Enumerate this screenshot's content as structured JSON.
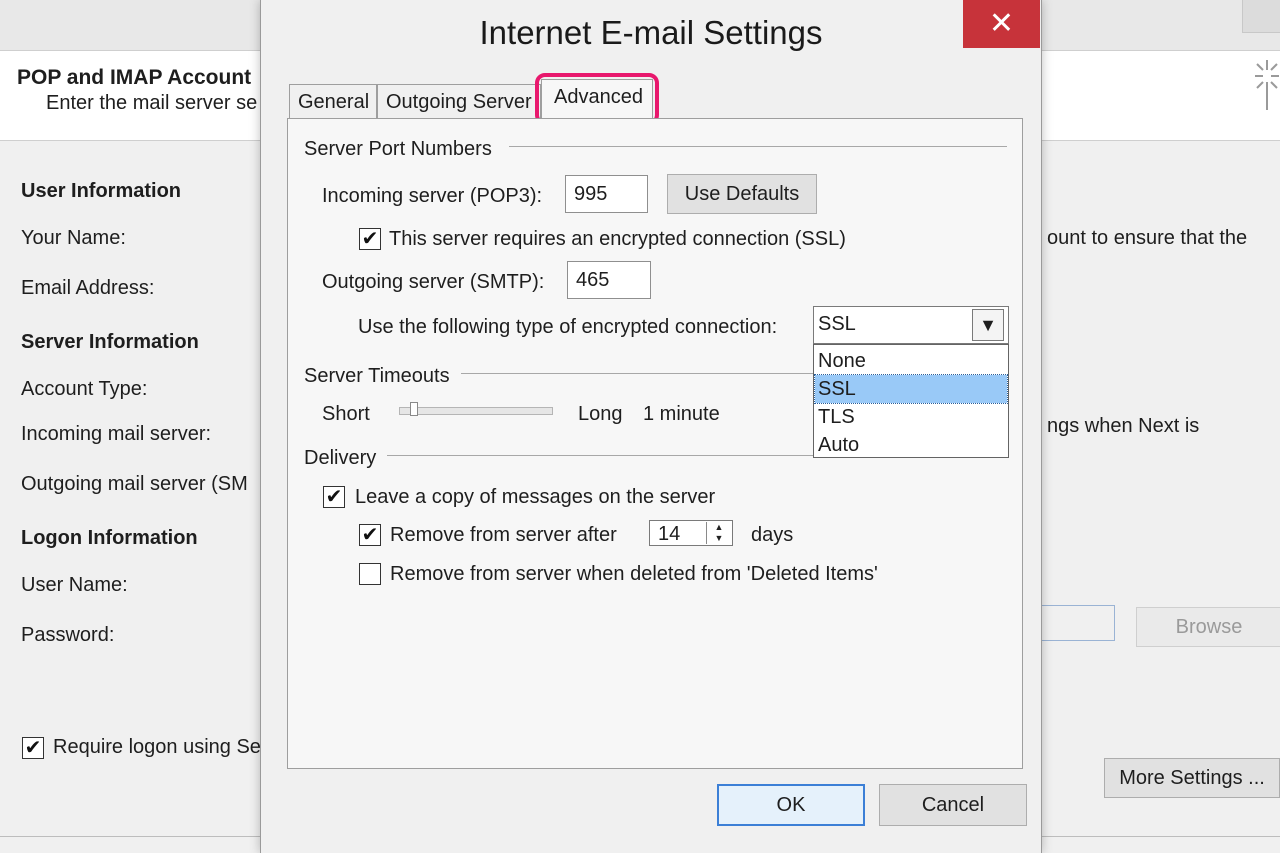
{
  "background": {
    "header_title": "POP and IMAP Account",
    "header_subtitle": "Enter the mail server se",
    "user_info_heading": "User Information",
    "your_name_label": "Your Name:",
    "email_label": "Email Address:",
    "server_info_heading": "Server Information",
    "account_type_label": "Account Type:",
    "incoming_label": "Incoming mail server:",
    "outgoing_label": "Outgoing mail server (SM",
    "logon_heading": "Logon Information",
    "username_label": "User Name:",
    "password_label": "Password:",
    "require_logon_label": "Require logon using Se",
    "require_logon_checked": true,
    "right_text_1": "ount to ensure that the",
    "right_text_2": "ngs when Next is",
    "browse_label": "Browse",
    "more_settings_label": "More Settings ..."
  },
  "dialog": {
    "title": "Internet E-mail Settings",
    "close_glyph": "✕",
    "tabs": [
      {
        "label": "General"
      },
      {
        "label": "Outgoing Server"
      },
      {
        "label": "Advanced",
        "active": true
      }
    ],
    "server_ports": {
      "heading": "Server Port Numbers",
      "incoming_label": "Incoming server (POP3):",
      "incoming_value": "995",
      "use_defaults_label": "Use Defaults",
      "ssl_required_label": "This server requires an encrypted connection (SSL)",
      "ssl_required_checked": true,
      "outgoing_label": "Outgoing server (SMTP):",
      "outgoing_value": "465",
      "encryption_label": "Use the following type of encrypted connection:",
      "encryption_selected": "SSL",
      "encryption_options": [
        "None",
        "SSL",
        "TLS",
        "Auto"
      ]
    },
    "timeouts": {
      "heading": "Server Timeouts",
      "short_label": "Short",
      "long_label": "Long",
      "value_text": "1 minute",
      "slider_level": 0.08
    },
    "delivery": {
      "heading": "Delivery",
      "leave_copy_label": "Leave a copy of messages on the server",
      "leave_copy_checked": true,
      "remove_after_label": "Remove from server after",
      "remove_after_checked": true,
      "remove_after_days": "14",
      "days_label": "days",
      "remove_deleted_label": "Remove from server when deleted from 'Deleted Items'",
      "remove_deleted_checked": false
    },
    "ok_label": "OK",
    "cancel_label": "Cancel"
  },
  "colors": {
    "highlight": "#e8186d",
    "close_button": "#c7333a",
    "selection": "#99c9f7",
    "ok_border": "#3c7fd6"
  }
}
